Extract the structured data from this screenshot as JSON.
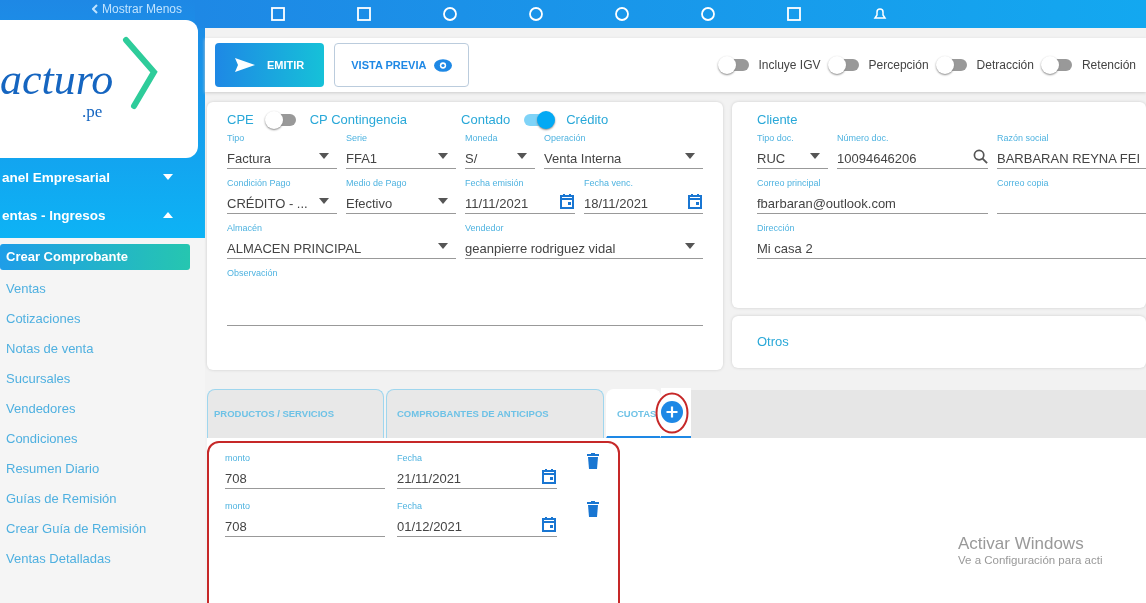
{
  "sidebar": {
    "toggle_label": "Mostrar Menos",
    "logo": {
      "text": "acturo",
      "suffix": ".pe"
    },
    "items": [
      {
        "kind": "section",
        "label": "anel Empresarial",
        "expanded": false
      },
      {
        "kind": "section",
        "label": "entas - Ingresos",
        "expanded": true
      },
      {
        "kind": "link",
        "label": "Crear Comprobante",
        "selected": true
      },
      {
        "kind": "link",
        "label": "Ventas",
        "selected": false
      },
      {
        "kind": "link",
        "label": "Cotizaciones",
        "selected": false
      },
      {
        "kind": "link",
        "label": "Notas de venta",
        "selected": false
      },
      {
        "kind": "link",
        "label": "Sucursales",
        "selected": false
      },
      {
        "kind": "link",
        "label": "Vendedores",
        "selected": false
      },
      {
        "kind": "link",
        "label": "Condiciones",
        "selected": false
      },
      {
        "kind": "link",
        "label": "Resumen Diario",
        "selected": false
      },
      {
        "kind": "link",
        "label": "Guías de Remisión",
        "selected": false
      },
      {
        "kind": "link",
        "label": "Crear Guía de Remisión",
        "selected": false
      },
      {
        "kind": "link",
        "label": "Ventas Detalladas",
        "selected": false
      }
    ]
  },
  "toolbar": {
    "emit_button": "EMITIR",
    "preview_button": "VISTA PREVIA",
    "switches": [
      {
        "label": "Incluye IGV",
        "on": false
      },
      {
        "label": "Percepción",
        "on": false
      },
      {
        "label": "Detracción",
        "on": false
      },
      {
        "label": "Retención",
        "on": false
      }
    ]
  },
  "document_card": {
    "switches": [
      {
        "left": "CPE",
        "right": "CP Contingencia",
        "on": false
      },
      {
        "left": "Contado",
        "right": "Crédito",
        "on": true
      }
    ],
    "fields": [
      {
        "label": "Tipo",
        "value": "Factura",
        "kind": "select"
      },
      {
        "label": "Serie",
        "value": "FFA1",
        "kind": "select"
      },
      {
        "label": "Moneda",
        "value": "S/",
        "kind": "select"
      },
      {
        "label": "Operación",
        "value": "Venta Interna",
        "kind": "select"
      },
      {
        "label": "Condición Pago",
        "value": "CRÉDITO - ...",
        "kind": "select"
      },
      {
        "label": "Medio de Pago",
        "value": "Efectivo",
        "kind": "select"
      },
      {
        "label": "Fecha emisión",
        "value": "11/11/2021",
        "kind": "date"
      },
      {
        "label": "Fecha venc.",
        "value": "18/11/2021",
        "kind": "date"
      },
      {
        "label": "Almacén",
        "value": "ALMACEN PRINCIPAL",
        "kind": "select"
      },
      {
        "label": "Vendedor",
        "value": "geanpierre rodriguez vidal",
        "kind": "select"
      },
      {
        "label": "Observación",
        "kind": "textarea"
      }
    ]
  },
  "client_card": {
    "title": "Cliente",
    "fields": [
      {
        "label": "Tipo doc.",
        "value": "RUC",
        "kind": "select"
      },
      {
        "label": "Número doc.",
        "value": "10094646206",
        "kind": "search"
      },
      {
        "label": "Razón social",
        "value": "BARBARAN REYNA FEI",
        "kind": "text"
      },
      {
        "label": "Correo principal",
        "value": "fbarbaran@outlook.com",
        "kind": "text"
      },
      {
        "label": "Correo copia",
        "kind": "text"
      },
      {
        "label": "Dirección",
        "value": "Mi casa 2",
        "kind": "text"
      }
    ]
  },
  "other_card": {
    "title": "Otros"
  },
  "tabs": [
    {
      "label": "PRODUCTOS / SERVICIOS",
      "selected": false
    },
    {
      "label": "COMPROBANTES DE ANTICIPOS",
      "selected": false
    },
    {
      "label": "CUOTAS",
      "selected": true
    }
  ],
  "installments": [
    {
      "amount_label": "monto",
      "amount": "708",
      "date_label": "Fecha",
      "date": "21/11/2021"
    },
    {
      "amount_label": "monto",
      "amount": "708",
      "date_label": "Fecha",
      "date": "01/12/2021"
    }
  ],
  "os_notice": {
    "title": "Activar Windows",
    "text": "Ve a Configuración para acti"
  }
}
